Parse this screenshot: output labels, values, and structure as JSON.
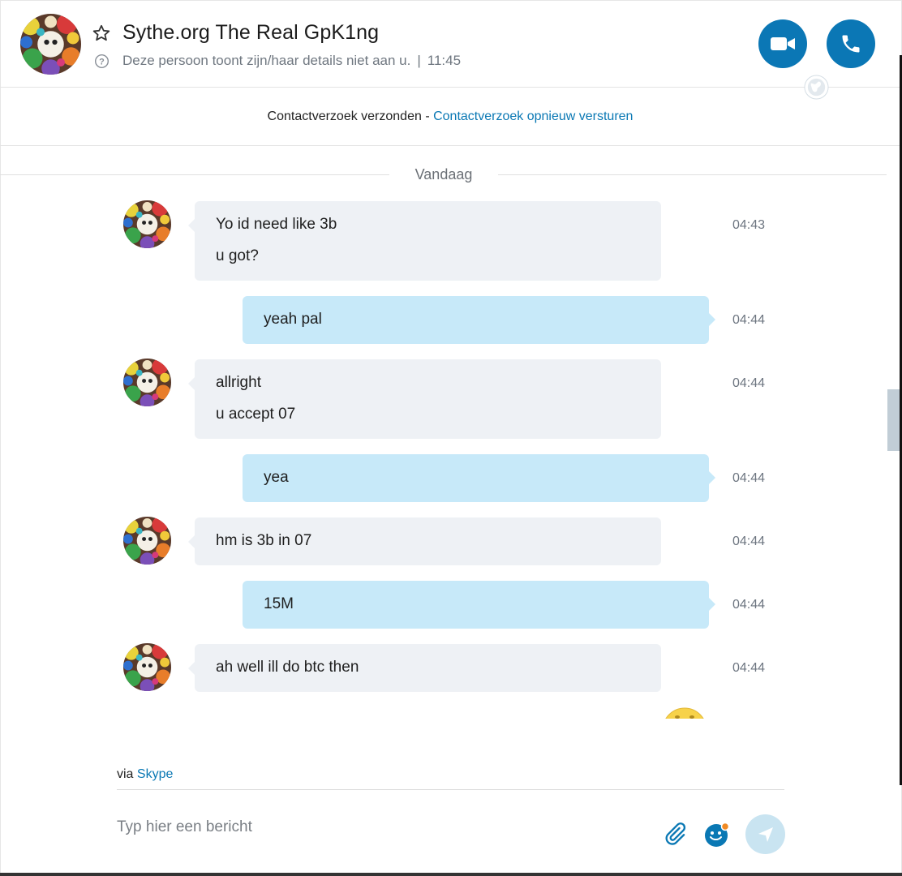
{
  "theme": {
    "accent": "#0b77b5",
    "link": "#0a78b4",
    "incoming_bubble": "#eef1f5",
    "outgoing_bubble": "#c7e9f9",
    "send_disabled": "#c9e4f1"
  },
  "header": {
    "title": "Sythe.org The Real GpK1ng",
    "status_text": "Deze persoon toont zijn/haar details niet aan u.",
    "separator": "|",
    "time": "11:45",
    "icons": {
      "favorite": "star-outline-icon",
      "help": "question-circle-icon",
      "video": "video-camera-icon",
      "audio": "phone-icon",
      "presence": "globe-icon"
    }
  },
  "request_bar": {
    "text": "Contactverzoek verzonden - ",
    "link": "Contactverzoek opnieuw versturen"
  },
  "day_divider": "Vandaag",
  "messages": [
    {
      "direction": "in",
      "lines": [
        "Yo id need like 3b",
        "u got?"
      ],
      "time": "04:43"
    },
    {
      "direction": "out",
      "lines": [
        "yeah pal"
      ],
      "time": "04:44"
    },
    {
      "direction": "in",
      "lines": [
        "allright",
        "u accept 07"
      ],
      "time": "04:44"
    },
    {
      "direction": "out",
      "lines": [
        "yea"
      ],
      "time": "04:44"
    },
    {
      "direction": "in",
      "lines": [
        "hm is 3b in 07"
      ],
      "time": "04:44"
    },
    {
      "direction": "out",
      "lines": [
        "15M"
      ],
      "time": "04:44"
    },
    {
      "direction": "in",
      "lines": [
        "ah well ill do btc then"
      ],
      "time": "04:44"
    }
  ],
  "composer": {
    "via_prefix": "via",
    "via_link": "Skype",
    "placeholder": "Typ hier een bericht",
    "value": "",
    "icons": {
      "attach": "paperclip-icon",
      "emoji": "smiley-icon",
      "send": "send-arrow-icon"
    }
  }
}
